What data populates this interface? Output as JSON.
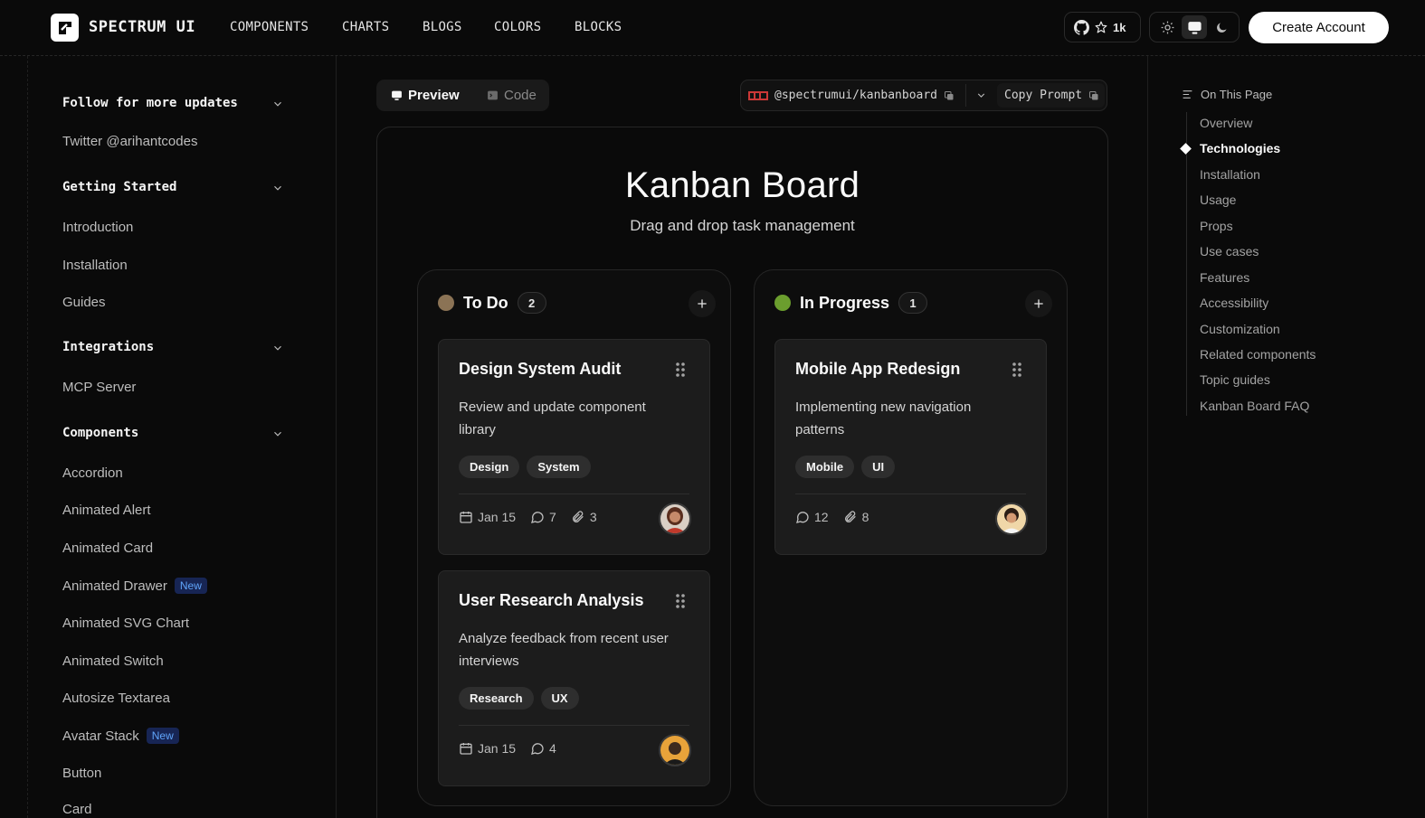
{
  "brand": {
    "name": "SPECTRUM UI"
  },
  "nav": [
    "COMPONENTS",
    "CHARTS",
    "BLOGS",
    "COLORS",
    "BLOCKS"
  ],
  "github": {
    "stars": "1k"
  },
  "cta": {
    "label": "Create Account"
  },
  "sidebar": {
    "sections": [
      {
        "title": "Follow for more updates",
        "items": [
          "Twitter @arihantcodes"
        ]
      },
      {
        "title": "Getting Started",
        "items": [
          "Introduction",
          "Installation",
          "Guides"
        ]
      },
      {
        "title": "Integrations",
        "items": [
          "MCP Server"
        ]
      },
      {
        "title": "Components",
        "items": [
          "Accordion",
          "Animated Alert",
          "Animated Card",
          "Animated Drawer",
          "Animated SVG Chart",
          "Animated Switch",
          "Autosize Textarea",
          "Avatar Stack",
          "Button",
          "Card"
        ]
      }
    ],
    "new_badge": "New"
  },
  "tabs": {
    "preview": "Preview",
    "code": "Code"
  },
  "package": {
    "name": "@spectrumui/kanbanboard",
    "copy_prompt": "Copy Prompt"
  },
  "board": {
    "title": "Kanban Board",
    "subtitle": "Drag and drop task management",
    "columns": [
      {
        "title": "To Do",
        "count": "2",
        "color": "#8b7355",
        "tasks": [
          {
            "title": "Design System Audit",
            "description": "Review and update component library",
            "tags": [
              "Design",
              "System"
            ],
            "date": "Jan 15",
            "comments": "7",
            "attachments": "3"
          },
          {
            "title": "User Research Analysis",
            "description": "Analyze feedback from recent user interviews",
            "tags": [
              "Research",
              "UX"
            ],
            "date": "Jan 15",
            "comments": "4"
          }
        ]
      },
      {
        "title": "In Progress",
        "count": "1",
        "color": "#6b9e2e",
        "tasks": [
          {
            "title": "Mobile App Redesign",
            "description": "Implementing new navigation patterns",
            "tags": [
              "Mobile",
              "UI"
            ],
            "comments": "12",
            "attachments": "8"
          }
        ]
      }
    ]
  },
  "toc": {
    "heading": "On This Page",
    "items": [
      "Overview",
      "Technologies",
      "Installation",
      "Usage",
      "Props",
      "Use cases",
      "Features",
      "Accessibility",
      "Customization",
      "Related components",
      "Topic guides",
      "Kanban Board FAQ"
    ],
    "active": "Technologies"
  }
}
